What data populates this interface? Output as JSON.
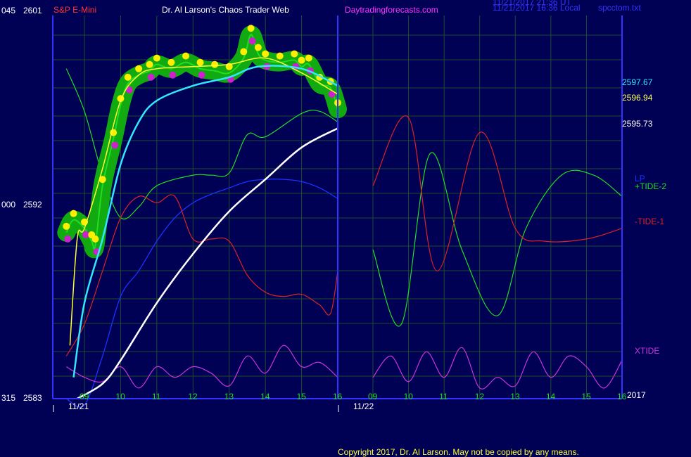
{
  "header": {
    "symbol": "S&P E-Mini",
    "title": "Dr. Al Larson's Chaos Trader Web",
    "site": "Daytradingforecasts.com",
    "timestamp_utc": "11/21/2017 21:36 UT",
    "timestamp_local": "11/21/2017 16:36 Local",
    "file": "spcctom.txt"
  },
  "left_axis": {
    "top": {
      "left": "045",
      "right": "2601"
    },
    "mid": {
      "left": "000",
      "right": "2592"
    },
    "bottom": {
      "left": "315",
      "right": "2583"
    }
  },
  "right_labels": {
    "price_1": "2597.67",
    "price_2": "2596.94",
    "price_3": "2595.73",
    "lp": "LP",
    "tide2": "+TIDE-2",
    "tide1": "-TIDE-1",
    "xtide": "XTIDE",
    "year": "2017"
  },
  "footer": "Copyright 2017, Dr. Al Larson.  May not be copied by any means.",
  "colors": {
    "background": "#000055",
    "grid": "#1e4d2b",
    "axis": "#3333ff",
    "price": "#22dd22",
    "price_glow": "#11aa11",
    "high_dot": "#ffee00",
    "low_dot": "#cc22cc",
    "yellow_avg": "#ffff33",
    "cyan_avg": "#33e6ff",
    "white_avg": "#ffffff",
    "lp": "#1a33ff",
    "tide_up": "#22dd22",
    "tide_down": "#dd2222",
    "xtide": "#cc33dd",
    "title_red": "#ff3333",
    "title_magenta": "#ff33ff"
  },
  "chart_data": {
    "type": "line",
    "title": "S&P E-Mini",
    "ylim": [
      2583,
      2601
    ],
    "x_tick_labels": [
      "09",
      "10",
      "11",
      "12",
      "13",
      "14",
      "15",
      "16",
      "09",
      "10",
      "11",
      "12",
      "13",
      "14",
      "15",
      "16"
    ],
    "x_date_labels": [
      "11/21",
      "11/22"
    ],
    "session_hours": [
      {
        "day": "11/21",
        "x": [
          9,
          16
        ]
      },
      {
        "day": "11/22",
        "x": [
          9,
          16
        ]
      }
    ],
    "series": [
      {
        "name": "S&P E-Mini",
        "day": "11/21",
        "x": [
          8.5,
          8.7,
          9.0,
          9.2,
          9.3,
          9.5,
          9.8,
          10.0,
          10.2,
          10.5,
          10.8,
          11.0,
          11.4,
          11.8,
          12.2,
          12.6,
          13.0,
          13.4,
          13.6,
          13.8,
          14.0,
          14.4,
          14.8,
          15.0,
          15.2,
          15.5,
          15.8,
          16.0
        ],
        "values": [
          2590.8,
          2591.4,
          2591.0,
          2590.4,
          2590.2,
          2593.0,
          2595.2,
          2596.8,
          2597.8,
          2598.2,
          2598.4,
          2598.7,
          2598.5,
          2598.8,
          2598.5,
          2598.4,
          2598.3,
          2599.0,
          2600.1,
          2599.2,
          2598.9,
          2598.8,
          2598.9,
          2598.6,
          2598.7,
          2597.8,
          2597.6,
          2596.6
        ]
      },
      {
        "name": "LP",
        "day": "11/21",
        "x": [
          8.5,
          9.0,
          9.5,
          10.0,
          10.5,
          11.0,
          11.5,
          12.0,
          12.5,
          13.0,
          13.5,
          14.0,
          14.5,
          15.0,
          15.5,
          16.0
        ],
        "values": [
          2583.0,
          2582.7,
          2585.0,
          2587.8,
          2589.0,
          2590.4,
          2591.5,
          2592.2,
          2592.6,
          2592.9,
          2593.2,
          2593.3,
          2593.3,
          2593.2,
          2592.9,
          2592.4
        ]
      },
      {
        "name": "+TIDE-2",
        "day": "11/21",
        "x": [
          8.5,
          9.0,
          9.5,
          10.0,
          10.5,
          11.0,
          12.0,
          12.5,
          13.0,
          13.5,
          14.0,
          15.0,
          15.5,
          16.0
        ],
        "values": [
          2598.5,
          2596.5,
          2593.5,
          2591.5,
          2592.0,
          2593.0,
          2593.5,
          2593.5,
          2593.6,
          2595.4,
          2595.3,
          2596.4,
          2596.5,
          2596.0
        ],
        "forecast": {
          "day": "11/22",
          "x": [
            9.0,
            9.8,
            10.6,
            11.5,
            12.5,
            13.3,
            14.3,
            15.2,
            16.0
          ],
          "values": [
            2590.0,
            2586.5,
            2594.5,
            2590.0,
            2586.9,
            2591.0,
            2593.5,
            2593.5,
            2592.5
          ]
        }
      },
      {
        "name": "-TIDE-1",
        "day": "11/21",
        "x": [
          8.5,
          9.0,
          9.5,
          10.0,
          10.5,
          11.0,
          11.5,
          12.0,
          12.5,
          13.0,
          13.5,
          14.0,
          14.5,
          15.0,
          15.5,
          15.8,
          16.0
        ],
        "values": [
          2585.0,
          2586.5,
          2589.0,
          2591.5,
          2592.5,
          2592.2,
          2592.5,
          2590.5,
          2590.5,
          2590.4,
          2588.8,
          2588.0,
          2587.8,
          2587.9,
          2587.4,
          2587.0,
          2589.0
        ],
        "forecast": {
          "day": "11/22",
          "x": [
            9.0,
            10.0,
            10.8,
            12.0,
            13.0,
            13.8,
            15.0,
            16.0
          ],
          "values": [
            2593.0,
            2596.2,
            2589.0,
            2595.5,
            2591.0,
            2590.4,
            2590.5,
            2591.0
          ]
        }
      },
      {
        "name": "XTIDE",
        "day": "11/21",
        "x": [
          8.5,
          9.0,
          9.5,
          10.0,
          10.5,
          11.0,
          11.5,
          12.0,
          12.5,
          13.0,
          13.5,
          14.0,
          14.5,
          15.0,
          15.5,
          16.0
        ],
        "values": [
          2584.5,
          2584.0,
          2583.8,
          2584.5,
          2583.5,
          2584.5,
          2584.0,
          2584.5,
          2584.2,
          2583.6,
          2585.0,
          2584.2,
          2585.5,
          2584.5,
          2584.7,
          2584.0
        ],
        "forecast": {
          "day": "11/22",
          "x": [
            9.0,
            9.5,
            10.0,
            10.5,
            11.0,
            11.5,
            12.0,
            12.5,
            13.0,
            13.5,
            14.0,
            14.5,
            15.0,
            15.5,
            16.0
          ],
          "values": [
            2584.0,
            2585.0,
            2583.8,
            2585.2,
            2584.0,
            2585.4,
            2583.5,
            2584.0,
            2583.6,
            2585.2,
            2584.0,
            2585.0,
            2584.5,
            2583.5,
            2584.8
          ]
        }
      }
    ],
    "moving_averages": [
      {
        "color": "yellow",
        "x": [
          8.6,
          8.8,
          9.0,
          9.5,
          10.0,
          10.5,
          11.0,
          12.0,
          13.0,
          14.0,
          15.0,
          16.0
        ],
        "values": [
          2585.5,
          2590.5,
          2591.0,
          2593.8,
          2597.0,
          2598.2,
          2598.5,
          2598.6,
          2598.7,
          2599.0,
          2598.3,
          2597.3
        ]
      },
      {
        "color": "cyan",
        "x": [
          8.7,
          9.0,
          9.5,
          10.0,
          10.5,
          11.0,
          12.0,
          13.0,
          13.8,
          15.0,
          16.0
        ],
        "values": [
          2584.0,
          2587.5,
          2590.5,
          2594.0,
          2596.0,
          2597.0,
          2597.7,
          2598.1,
          2598.6,
          2598.5,
          2597.7
        ]
      },
      {
        "color": "white",
        "x": [
          8.8,
          9.5,
          10.0,
          11.0,
          12.0,
          13.0,
          14.0,
          15.0,
          16.0
        ],
        "values": [
          2583.0,
          2583.7,
          2584.8,
          2587.5,
          2589.8,
          2591.8,
          2593.3,
          2594.8,
          2595.7
        ]
      }
    ]
  }
}
